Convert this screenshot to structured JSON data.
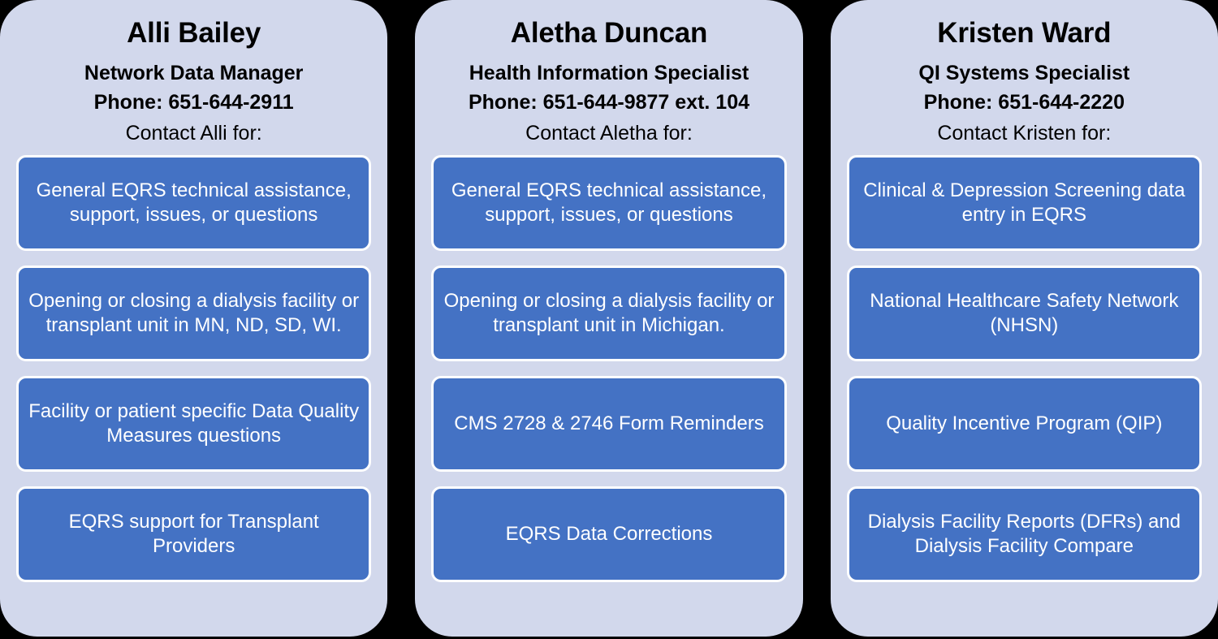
{
  "theme": {
    "card_background": "#D2D8EC",
    "topic_box_background": "#4472C4",
    "topic_box_border": "#FFFFFF",
    "topic_text_color": "#FFFFFF",
    "header_text_color": "#000000",
    "page_background": "#000000"
  },
  "cards": [
    {
      "name": "Alli Bailey",
      "title": "Network Data Manager",
      "phone": "Phone: 651-644-2911",
      "prompt": "Contact Alli for:",
      "topics": [
        "General  EQRS technical assistance, support, issues, or questions",
        "Opening or closing a dialysis facility or transplant unit in MN, ND, SD, WI.",
        "Facility or patient specific Data Quality Measures questions",
        "EQRS support for Transplant Providers"
      ]
    },
    {
      "name": "Aletha Duncan",
      "title": "Health Information Specialist",
      "phone": "Phone: 651-644-9877 ext. 104",
      "prompt": "Contact Aletha for:",
      "topics": [
        "General  EQRS technical assistance, support, issues, or questions",
        "Opening or closing a dialysis facility or transplant unit in Michigan.",
        "CMS 2728 & 2746 Form Reminders",
        "EQRS Data Corrections"
      ]
    },
    {
      "name": "Kristen Ward",
      "title": "QI Systems Specialist",
      "phone": "Phone: 651-644-2220",
      "prompt": "Contact Kristen for:",
      "topics": [
        "Clinical & Depression Screening data entry in EQRS",
        "National Healthcare Safety Network (NHSN)",
        "Quality Incentive Program (QIP)",
        "Dialysis Facility Reports (DFRs) and Dialysis Facility Compare"
      ]
    }
  ]
}
